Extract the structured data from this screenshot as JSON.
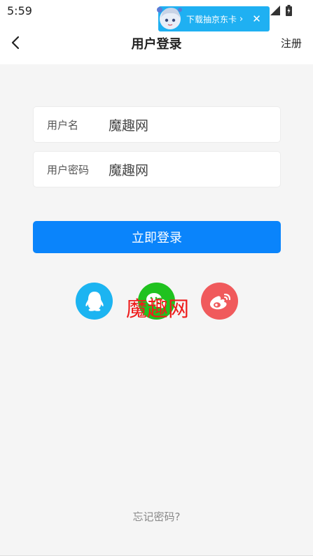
{
  "status_bar": {
    "time": "5:59"
  },
  "promo": {
    "text": "下载抽京东卡",
    "arrow": "›",
    "close": "✕"
  },
  "header": {
    "back_icon": "chevron-left-icon",
    "title": "用户登录",
    "register_label": "注册"
  },
  "form": {
    "username": {
      "label": "用户名",
      "value": "魔趣网"
    },
    "password": {
      "label": "用户密码",
      "value": "魔趣网"
    },
    "login_label": "立即登录"
  },
  "social_login": {
    "icons": [
      "qq-icon",
      "wechat-icon",
      "weibo-icon"
    ],
    "colors": {
      "qq": "#1cb4f1",
      "wechat": "#20c21f",
      "weibo": "#f05a5c"
    }
  },
  "watermark": "魔趣网",
  "forgot_label": "忘记密码?",
  "colors": {
    "primary": "#0a84fb",
    "promo": "#1fb0f2",
    "background": "#f5f5f5"
  }
}
